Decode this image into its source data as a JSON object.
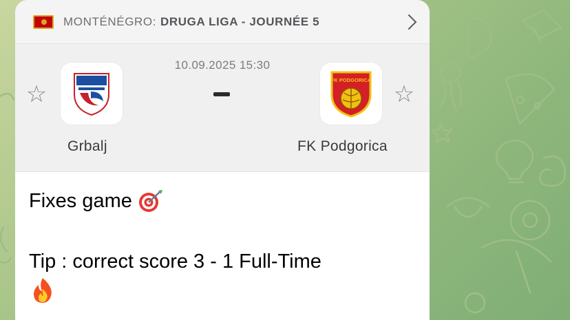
{
  "header": {
    "country": "MONTÉNÉGRO:",
    "league": "DRUGA LIGA - JOURNÉE 5"
  },
  "match": {
    "datetime": "10.09.2025 15:30",
    "home_team": "Grbalj",
    "away_team": "FK Podgorica",
    "away_logo_text": "FK PODGORICA"
  },
  "message": {
    "line1": "Fixes game",
    "line2": "Tip : correct score 3 - 1  Full-Time"
  },
  "colors": {
    "flag_red": "#c40308",
    "flag_gold": "#d6a82a",
    "background": "#a9c58a"
  }
}
